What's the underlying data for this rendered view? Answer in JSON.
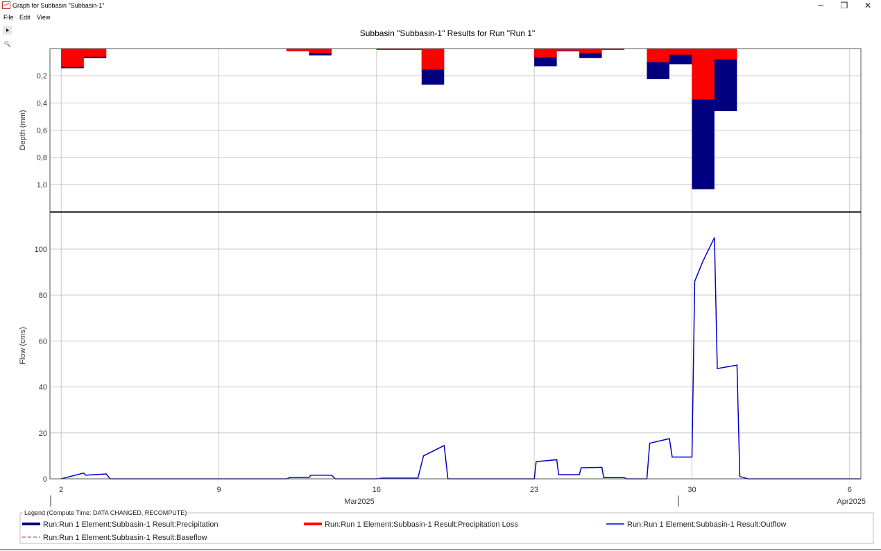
{
  "window": {
    "title": "Graph for Subbasin \"Subbasin-1\"",
    "minimize_glyph": "─",
    "maximize_glyph": "❐",
    "close_glyph": "✕"
  },
  "menu": [
    "File",
    "Edit",
    "View"
  ],
  "tools": [
    {
      "icon": "pointer-icon",
      "glyph": "➤"
    },
    {
      "icon": "zoom-icon",
      "glyph": "🔍"
    }
  ],
  "chart_data": [
    {
      "type": "bar",
      "title": "Subbasin \"Subbasin-1\" Results for Run \"Run 1\"",
      "ylabel": "Depth (mm)",
      "ylim": [
        1.2,
        0
      ],
      "inverted_y": true,
      "yticks": [
        0.2,
        0.4,
        0.6,
        0.8,
        1.0
      ],
      "ytick_labels": [
        "0,2",
        "0,4",
        "0,6",
        "0,8",
        "1,0"
      ],
      "grid": true,
      "bar_width_days": 1,
      "series": [
        {
          "name": "Run:Run 1 Element:Subbasin-1 Result:Precipitation",
          "color": "#000080"
        },
        {
          "name": "Run:Run 1 Element:Subbasin-1 Result:Precipitation Loss",
          "color": "#ff0000"
        }
      ],
      "bars": [
        {
          "x": "2025-03-02",
          "precipitation": 0.145,
          "loss": 0.135
        },
        {
          "x": "2025-03-03",
          "precipitation": 0.07,
          "loss": 0.06
        },
        {
          "x": "2025-03-12",
          "precipitation": 0.02,
          "loss": 0.02
        },
        {
          "x": "2025-03-13",
          "precipitation": 0.05,
          "loss": 0.035
        },
        {
          "x": "2025-03-16",
          "precipitation": 0.01,
          "loss": 0.01
        },
        {
          "x": "2025-03-17",
          "precipitation": 0.01,
          "loss": 0.01
        },
        {
          "x": "2025-03-18",
          "precipitation": 0.265,
          "loss": 0.155
        },
        {
          "x": "2025-03-23",
          "precipitation": 0.13,
          "loss": 0.065
        },
        {
          "x": "2025-03-24",
          "precipitation": 0.02,
          "loss": 0.015
        },
        {
          "x": "2025-03-25",
          "precipitation": 0.07,
          "loss": 0.035
        },
        {
          "x": "2025-03-26",
          "precipitation": 0.01,
          "loss": 0.01
        },
        {
          "x": "2025-03-28",
          "precipitation": 0.225,
          "loss": 0.1
        },
        {
          "x": "2025-03-29",
          "precipitation": 0.115,
          "loss": 0.045
        },
        {
          "x": "2025-03-30",
          "precipitation": 1.035,
          "loss": 0.375
        },
        {
          "x": "2025-03-31",
          "precipitation": 0.46,
          "loss": 0.08
        }
      ]
    },
    {
      "type": "line",
      "ylabel": "Flow (cms)",
      "ylim": [
        0,
        116
      ],
      "yticks": [
        0,
        20,
        40,
        60,
        80,
        100
      ],
      "ytick_labels": [
        "0",
        "20",
        "40",
        "60",
        "80",
        "100"
      ],
      "grid": true,
      "xlim": [
        "2025-03-01 12:00",
        "2025-04-06 12:00"
      ],
      "xticks": [
        "2025-03-02",
        "2025-03-09",
        "2025-03-16",
        "2025-03-23",
        "2025-03-30",
        "2025-04-06"
      ],
      "xtick_labels": [
        "2",
        "9",
        "16",
        "23",
        "30",
        "6"
      ],
      "xmajor_labels": [
        "Mar2025",
        "Apr2025"
      ],
      "series": [
        {
          "name": "Run:Run 1 Element:Subbasin-1 Result:Outflow",
          "color": "#0000cc",
          "style": "solid",
          "points": [
            [
              "2025-03-02 00:00",
              0
            ],
            [
              "2025-03-03 00:00",
              2.5
            ],
            [
              "2025-03-03 02:00",
              1.6
            ],
            [
              "2025-03-04 00:00",
              2.1
            ],
            [
              "2025-03-04 04:00",
              0
            ],
            [
              "2025-03-12 00:00",
              0
            ],
            [
              "2025-03-12 04:00",
              0.6
            ],
            [
              "2025-03-13 00:00",
              0.6
            ],
            [
              "2025-03-13 02:00",
              1.6
            ],
            [
              "2025-03-14 00:00",
              1.6
            ],
            [
              "2025-03-14 04:00",
              0
            ],
            [
              "2025-03-16 00:00",
              0
            ],
            [
              "2025-03-16 06:00",
              0.3
            ],
            [
              "2025-03-17 20:00",
              0.3
            ],
            [
              "2025-03-18 02:00",
              10
            ],
            [
              "2025-03-19 00:00",
              14.5
            ],
            [
              "2025-03-19 04:00",
              0
            ],
            [
              "2025-03-23 00:00",
              0
            ],
            [
              "2025-03-23 02:00",
              7.5
            ],
            [
              "2025-03-24 00:00",
              8.3
            ],
            [
              "2025-03-24 02:00",
              1.8
            ],
            [
              "2025-03-25 00:00",
              1.8
            ],
            [
              "2025-03-25 02:00",
              4.8
            ],
            [
              "2025-03-26 00:00",
              5.0
            ],
            [
              "2025-03-26 02:00",
              0.5
            ],
            [
              "2025-03-27 00:00",
              0.5
            ],
            [
              "2025-03-27 02:00",
              0
            ],
            [
              "2025-03-28 00:00",
              0
            ],
            [
              "2025-03-28 03:00",
              15.5
            ],
            [
              "2025-03-29 00:00",
              17.5
            ],
            [
              "2025-03-29 03:00",
              9.5
            ],
            [
              "2025-03-30 00:00",
              9.5
            ],
            [
              "2025-03-30 03:00",
              86
            ],
            [
              "2025-03-30 12:00",
              95
            ],
            [
              "2025-03-31 00:00",
              105
            ],
            [
              "2025-03-31 03:00",
              48
            ],
            [
              "2025-04-01 00:00",
              49.5
            ],
            [
              "2025-04-01 03:00",
              1
            ],
            [
              "2025-04-01 12:00",
              0
            ],
            [
              "2025-04-06 12:00",
              0
            ]
          ]
        },
        {
          "name": "Run:Run 1 Element:Subbasin-1 Result:Baseflow",
          "color": "#c06040",
          "style": "dashed",
          "points": [
            [
              "2025-03-02 00:00",
              0
            ],
            [
              "2025-04-06 12:00",
              0
            ]
          ]
        }
      ]
    }
  ],
  "legend": {
    "title": "Legend (Compute Time: DATA CHANGED, RECOMPUTE)",
    "placement": "bottom",
    "items": [
      {
        "label": "Run:Run 1 Element:Subbasin-1 Result:Precipitation",
        "color": "#000080",
        "style": "thick"
      },
      {
        "label": "Run:Run 1 Element:Subbasin-1 Result:Precipitation Loss",
        "color": "#ff0000",
        "style": "thick"
      },
      {
        "label": "Run:Run 1 Element:Subbasin-1 Result:Outflow",
        "color": "#0000cc",
        "style": "thin"
      },
      {
        "label": "Run:Run 1 Element:Subbasin-1 Result:Baseflow",
        "color": "#c06040",
        "style": "dashed"
      }
    ]
  }
}
